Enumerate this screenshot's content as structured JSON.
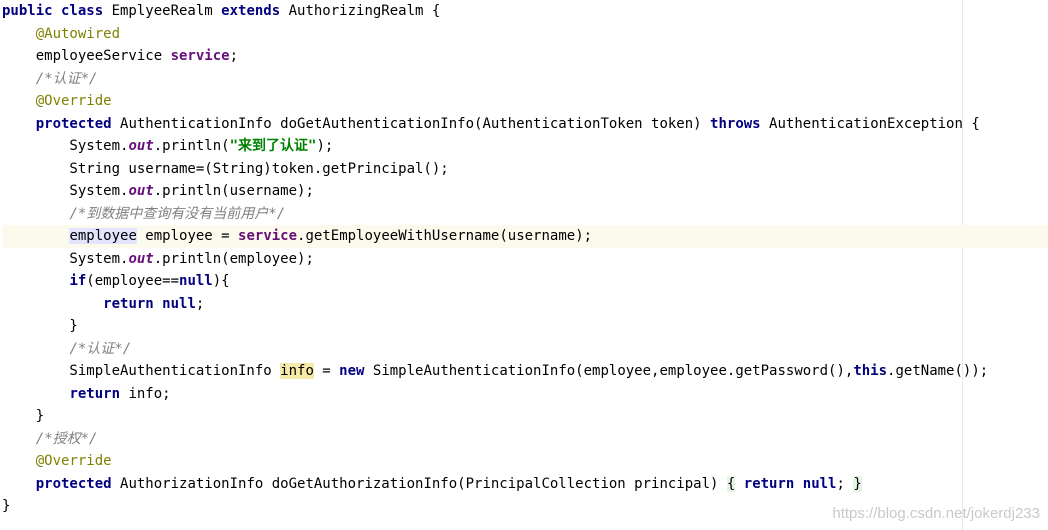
{
  "editor": {
    "lines": [
      [
        {
          "t": "public class ",
          "c": "kw"
        },
        {
          "t": "EmplyeeRealm ",
          "c": "pl"
        },
        {
          "t": "extends ",
          "c": "kw"
        },
        {
          "t": "AuthorizingRealm {",
          "c": "pl"
        }
      ],
      [
        {
          "t": "    ",
          "c": "pl"
        },
        {
          "t": "@Autowired",
          "c": "ann"
        }
      ],
      [
        {
          "t": "    employeeService ",
          "c": "pl"
        },
        {
          "t": "service",
          "c": "fld"
        },
        {
          "t": ";",
          "c": "pl"
        }
      ],
      [
        {
          "t": "    ",
          "c": "pl"
        },
        {
          "t": "/*认证*/",
          "c": "cm"
        }
      ],
      [
        {
          "t": "    ",
          "c": "pl"
        },
        {
          "t": "@Override",
          "c": "ann"
        }
      ],
      [
        {
          "t": "    ",
          "c": "pl"
        },
        {
          "t": "protected ",
          "c": "kw"
        },
        {
          "t": "AuthenticationInfo doGetAuthenticationInfo(AuthenticationToken token) ",
          "c": "pl"
        },
        {
          "t": "throws ",
          "c": "kw"
        },
        {
          "t": "AuthenticationException {",
          "c": "pl"
        }
      ],
      [
        {
          "t": "        System.",
          "c": "pl"
        },
        {
          "t": "out",
          "c": "sfld"
        },
        {
          "t": ".println(",
          "c": "pl"
        },
        {
          "t": "\"来到了认证\"",
          "c": "str"
        },
        {
          "t": ");",
          "c": "pl"
        }
      ],
      [
        {
          "t": "        String username=(String)token.getPrincipal();",
          "c": "pl"
        }
      ],
      [
        {
          "t": "        System.",
          "c": "pl"
        },
        {
          "t": "out",
          "c": "sfld"
        },
        {
          "t": ".println(username);",
          "c": "pl"
        }
      ],
      [
        {
          "t": "        ",
          "c": "pl"
        },
        {
          "t": "/*到数据中查询有没有当前用户*/",
          "c": "cm"
        }
      ],
      [
        {
          "t": "        ",
          "c": "pl"
        },
        {
          "t": "empl",
          "c": "pl hl-sel"
        },
        {
          "caret": true
        },
        {
          "t": "oyee",
          "c": "pl hl-sel"
        },
        {
          "t": " employee = ",
          "c": "pl"
        },
        {
          "t": "service",
          "c": "fld"
        },
        {
          "t": ".getEmployeeWithUsername(username);",
          "c": "pl"
        }
      ],
      [
        {
          "t": "        System.",
          "c": "pl"
        },
        {
          "t": "out",
          "c": "sfld"
        },
        {
          "t": ".println(employee);",
          "c": "pl"
        }
      ],
      [
        {
          "t": "        ",
          "c": "pl"
        },
        {
          "t": "if",
          "c": "kw"
        },
        {
          "t": "(employee==",
          "c": "pl"
        },
        {
          "t": "null",
          "c": "kw"
        },
        {
          "t": "){",
          "c": "pl"
        }
      ],
      [
        {
          "t": "            ",
          "c": "pl"
        },
        {
          "t": "return null",
          "c": "kw"
        },
        {
          "t": ";",
          "c": "pl"
        }
      ],
      [
        {
          "t": "        }",
          "c": "pl"
        }
      ],
      [
        {
          "t": "        ",
          "c": "pl"
        },
        {
          "t": "/*认证*/",
          "c": "cm"
        }
      ],
      [
        {
          "t": "        SimpleAuthenticationInfo ",
          "c": "pl"
        },
        {
          "t": "info",
          "c": "pl hl-use"
        },
        {
          "t": " = ",
          "c": "pl"
        },
        {
          "t": "new ",
          "c": "kw"
        },
        {
          "t": "SimpleAuthenticationInfo(employee,employee.getPassword(),",
          "c": "pl"
        },
        {
          "t": "this",
          "c": "kw"
        },
        {
          "t": ".getName());",
          "c": "pl"
        }
      ],
      [
        {
          "t": "        ",
          "c": "pl"
        },
        {
          "t": "return ",
          "c": "kw"
        },
        {
          "t": "info;",
          "c": "pl"
        }
      ],
      [
        {
          "t": "    }",
          "c": "pl"
        }
      ],
      [
        {
          "t": "    ",
          "c": "pl"
        },
        {
          "t": "/*授权*/",
          "c": "cm"
        }
      ],
      [
        {
          "t": "    ",
          "c": "pl"
        },
        {
          "t": "@Override",
          "c": "ann"
        }
      ],
      [
        {
          "t": "    ",
          "c": "pl"
        },
        {
          "t": "protected ",
          "c": "kw"
        },
        {
          "t": "AuthorizationInfo doGetAuthorizationInfo(PrincipalCollection principal) ",
          "c": "pl"
        },
        {
          "t": "{",
          "c": "pl hl-brace"
        },
        {
          "t": " ",
          "c": "pl"
        },
        {
          "t": "return null",
          "c": "kw"
        },
        {
          "t": "; ",
          "c": "pl"
        },
        {
          "t": "}",
          "c": "pl hl-brace"
        }
      ],
      [
        {
          "t": "}",
          "c": "pl"
        }
      ]
    ],
    "current_line": 10
  },
  "watermark": "https://blog.csdn.net/jokerdj233"
}
